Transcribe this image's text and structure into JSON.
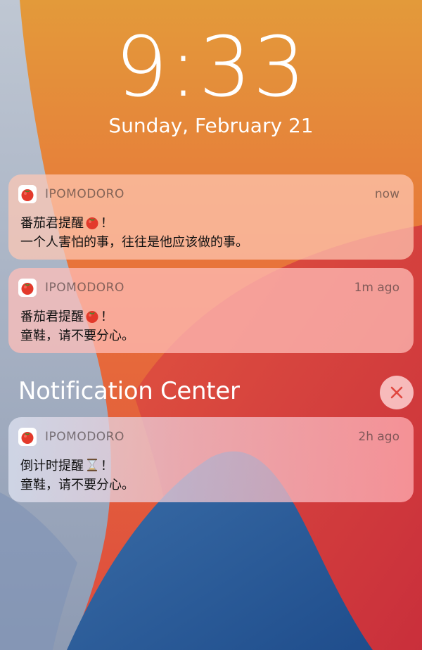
{
  "lock_screen": {
    "time": "9:33",
    "date": "Sunday, February 21"
  },
  "notifications": [
    {
      "app_name": "IPOMODORO",
      "time": "now",
      "title": "番茄君提醒",
      "title_emoji": "tomato-icon",
      "title_suffix": "！",
      "body": "一个人害怕的事，往往是他应该做的事。"
    },
    {
      "app_name": "IPOMODORO",
      "time": "1m ago",
      "title": "番茄君提醒",
      "title_emoji": "tomato-icon",
      "title_suffix": "！",
      "body": "童鞋，请不要分心。"
    }
  ],
  "notification_center": {
    "title": "Notification Center",
    "close_icon": "close-icon",
    "items": [
      {
        "app_name": "IPOMODORO",
        "time": "2h ago",
        "title": "倒计时提醒",
        "title_emoji": "hourglass-icon",
        "title_suffix": "！",
        "body": "童鞋，请不要分心。"
      }
    ]
  },
  "colors": {
    "wallpaper_top": "#E8963A",
    "wallpaper_red": "#D8423E",
    "wallpaper_blue": "#2F5E96",
    "text_white": "#FFFFFF"
  }
}
